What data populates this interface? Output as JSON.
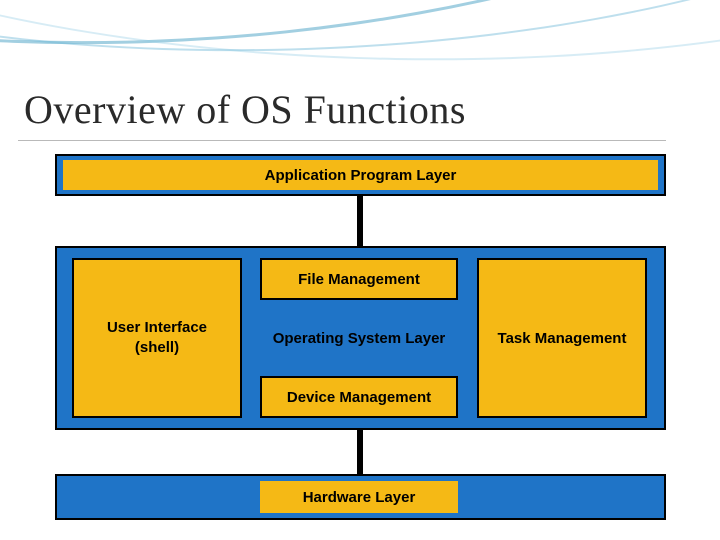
{
  "title": "Overview of OS Functions",
  "layers": {
    "application": "Application Program Layer",
    "os_label": "Operating System Layer",
    "hardware": "Hardware Layer"
  },
  "os_components": {
    "user_interface_line1": "User Interface",
    "user_interface_line2": "(shell)",
    "file_management": "File Management",
    "device_management": "Device Management",
    "task_management": "Task Management"
  },
  "colors": {
    "blue": "#1f74c7",
    "orange": "#f5b915"
  }
}
